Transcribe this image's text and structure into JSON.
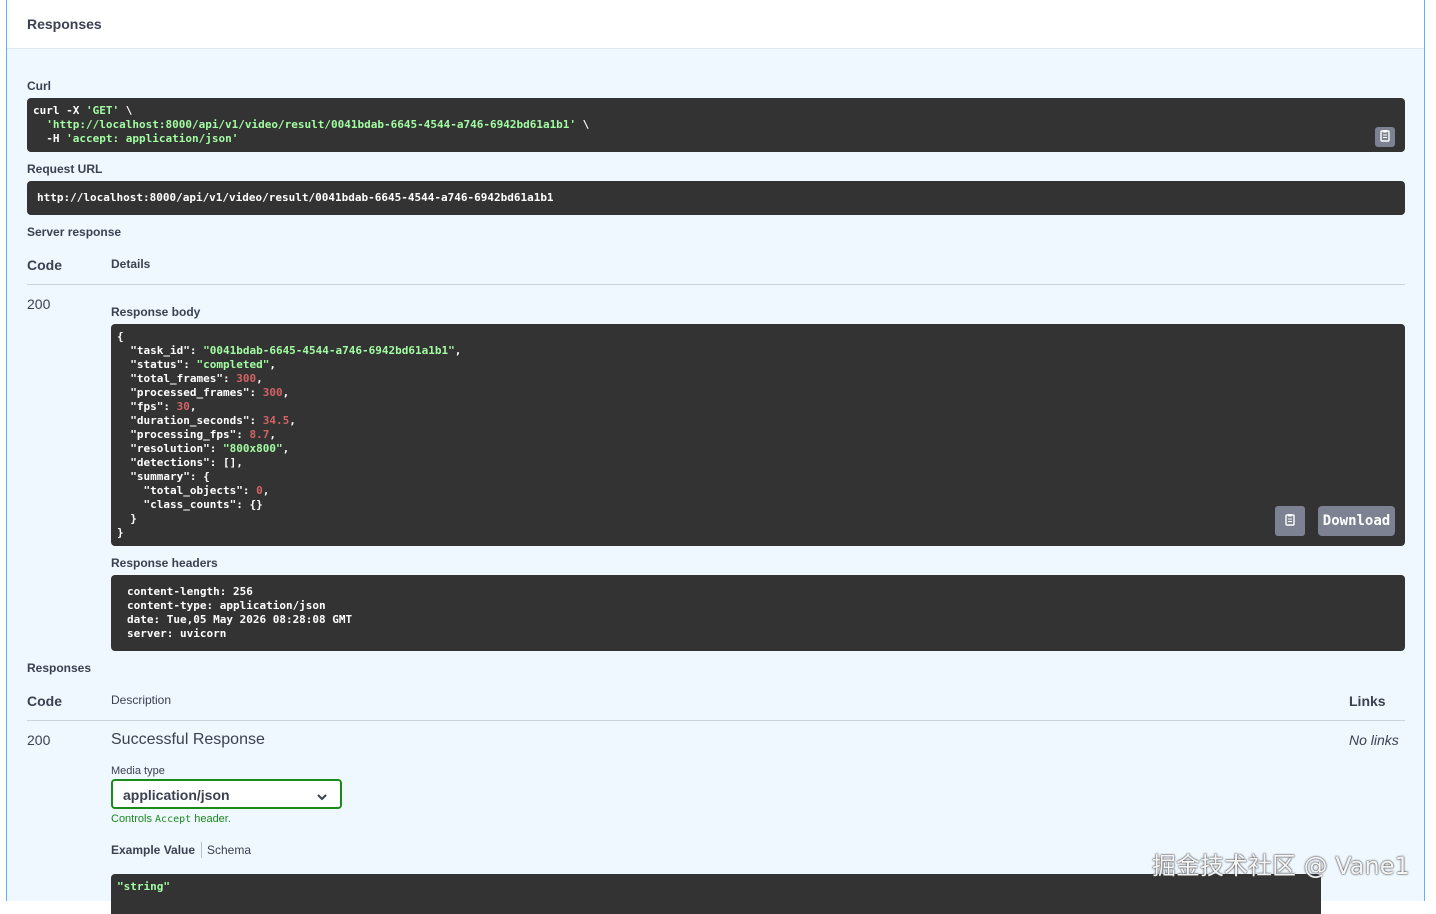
{
  "header": {
    "title": "Responses"
  },
  "curl": {
    "label": "Curl",
    "lines": [
      [
        "curl -X ",
        "'GET'",
        " \\"
      ],
      [
        "  ",
        "'http://localhost:8000/api/v1/video/result/0041bdab-6645-4544-a746-6942bd61a1b1'",
        " \\"
      ],
      [
        "  -H ",
        "'accept: application/json'",
        ""
      ]
    ],
    "copy_icon": "clipboard-icon"
  },
  "request_url": {
    "label": "Request URL",
    "value": "http://localhost:8000/api/v1/video/result/0041bdab-6645-4544-a746-6942bd61a1b1"
  },
  "server_response": {
    "label": "Server response",
    "col_code": "Code",
    "col_details": "Details",
    "code": "200",
    "body_label": "Response body",
    "body_lines": [
      [
        {
          "t": "{"
        }
      ],
      [
        {
          "t": "  \"task_id\": "
        },
        {
          "t": "\"0041bdab-6645-4544-a746-6942bd61a1b1\"",
          "c": "str"
        },
        {
          "t": ","
        }
      ],
      [
        {
          "t": "  \"status\": "
        },
        {
          "t": "\"completed\"",
          "c": "str"
        },
        {
          "t": ","
        }
      ],
      [
        {
          "t": "  \"total_frames\": "
        },
        {
          "t": "300",
          "c": "num"
        },
        {
          "t": ","
        }
      ],
      [
        {
          "t": "  \"processed_frames\": "
        },
        {
          "t": "300",
          "c": "num"
        },
        {
          "t": ","
        }
      ],
      [
        {
          "t": "  \"fps\": "
        },
        {
          "t": "30",
          "c": "num"
        },
        {
          "t": ","
        }
      ],
      [
        {
          "t": "  \"duration_seconds\": "
        },
        {
          "t": "34.5",
          "c": "num"
        },
        {
          "t": ","
        }
      ],
      [
        {
          "t": "  \"processing_fps\": "
        },
        {
          "t": "8.7",
          "c": "num"
        },
        {
          "t": ","
        }
      ],
      [
        {
          "t": "  \"resolution\": "
        },
        {
          "t": "\"800x800\"",
          "c": "str"
        },
        {
          "t": ","
        }
      ],
      [
        {
          "t": "  \"detections\": [],"
        }
      ],
      [
        {
          "t": "  \"summary\": {"
        }
      ],
      [
        {
          "t": "    \"total_objects\": "
        },
        {
          "t": "0",
          "c": "num"
        },
        {
          "t": ","
        }
      ],
      [
        {
          "t": "    \"class_counts\": {}"
        }
      ],
      [
        {
          "t": "  }"
        }
      ],
      [
        {
          "t": "}"
        }
      ]
    ],
    "download_label": "Download",
    "headers_label": "Response headers",
    "headers_lines": [
      "content-length: 256",
      "content-type: application/json",
      "date: Tue,05 May 2026 08:28:08 GMT",
      "server: uvicorn"
    ]
  },
  "responses": {
    "label": "Responses",
    "col_code": "Code",
    "col_description": "Description",
    "col_links": "Links",
    "code": "200",
    "description": "Successful Response",
    "links": "No links",
    "media_type_label": "Media type",
    "media_type_value": "application/json",
    "controls_prefix": "Controls ",
    "controls_code": "Accept",
    "controls_suffix": " header.",
    "tab_example": "Example Value",
    "tab_schema": "Schema",
    "example_value": "\"string\""
  },
  "watermark": "掘金技术社区 @ Vane1",
  "colors": {
    "accent": "#61affe",
    "code_bg": "#333333",
    "string": "#a2fca2",
    "number": "#d36363",
    "select_border": "#1a8a1a"
  }
}
